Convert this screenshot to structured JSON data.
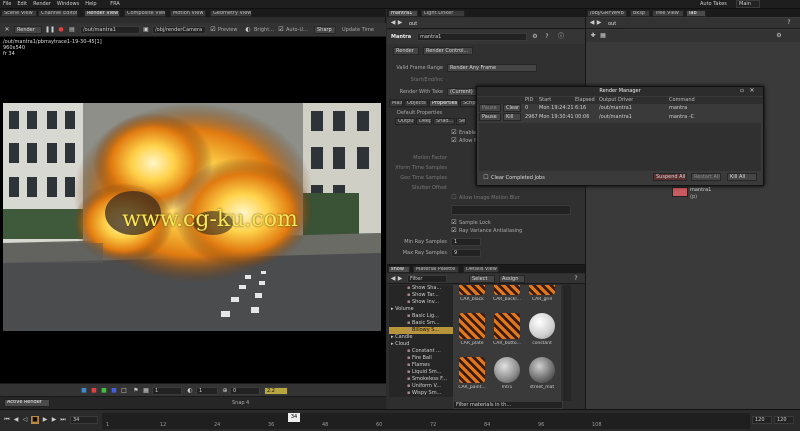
{
  "menubar": {
    "items": [
      "File",
      "Edit",
      "Render",
      "Windows",
      "Help"
    ],
    "extra": "FRA",
    "right_label": "Auto Takes",
    "right_field": "Main"
  },
  "left_tabs": [
    "Scene View",
    "Channel Editor",
    "Render View",
    "Composite View",
    "Motion View",
    "Geometry View"
  ],
  "viewer_toolbar": {
    "render_button": "Render",
    "path_field": "/out/mantra1",
    "camera_field": "/obj/renderCamera",
    "preview_label": "Preview",
    "brightness_label": "Bright...",
    "auto_label": "Auto-U...",
    "sharp_label": "Sharp",
    "update_label": "Update Time"
  },
  "viewer": {
    "path_label": "/out/mantra1/pbrraytrace1-19-30-45[1]",
    "info_line1": "960x540",
    "info_line2": "fr 34"
  },
  "viewer_bottom": {
    "frame_field": "1",
    "value_field": "1",
    "zoom_field": "0",
    "exposure_field": "2.2",
    "snap_label": "Snap",
    "snap_value": "4"
  },
  "status_bar": {
    "active_render_tab": "Active Render"
  },
  "timeline": {
    "frame_field": "34",
    "ticks": [
      "1",
      "12",
      "24",
      "36",
      "48",
      "60",
      "72",
      "84",
      "96",
      "108"
    ],
    "current_frame": "34",
    "end_field": "120",
    "end_field2": "120"
  },
  "mid_tabs": [
    "mantra1",
    "Light Linker"
  ],
  "mid_path": "out",
  "mantra": {
    "node_type": "Mantra",
    "node_name": "mantra1",
    "render_button": "Render",
    "render_control_button": "Render Control...",
    "frame_range_label": "Valid Frame Range",
    "frame_range_value": "Render Any Frame",
    "start_end_label": "Start/End/Inc",
    "render_takes_label": "Render With Take",
    "render_takes_value": "(Current)",
    "tabs": [
      "Main",
      "Objects",
      "Properties",
      "Script"
    ],
    "sub_label": "Default Properties",
    "sub_tabs": [
      "Output",
      "Deep",
      "Shad...",
      "Se"
    ],
    "enable_label": "Enable",
    "allow_label": "Allow M...",
    "faint_rows": [
      "Motion Factor",
      "Xform Time Samples",
      "Geo Time Samples",
      "Shutter Offset"
    ],
    "allow_image_blur": "Allow Image Motion Blur",
    "sample_lock": "Sample Lock",
    "ray_variance": "Ray Variance Antialiasing",
    "min_ray_label": "Min Ray Samples",
    "min_ray_value": "1",
    "max_ray_label": "Max Ray Samples",
    "max_ray_value": "9"
  },
  "render_manager": {
    "title": "Render Manager",
    "columns": [
      "PID",
      "Start",
      "Elapsed",
      "Output Driver",
      "Command"
    ],
    "rows": [
      {
        "pause": "Pause",
        "action": "Clear",
        "pid": "0",
        "start": "Mon 19:24:21",
        "elapsed": "6:16",
        "driver": "/out/mantra1",
        "command": "mantra"
      },
      {
        "pause": "Pause",
        "action": "Kill",
        "pid": "2967",
        "start": "Mon 19:30:41",
        "elapsed": "00:06",
        "driver": "/out/mantra1",
        "command": "mantra -C"
      }
    ],
    "clear_completed": "Clear Completed Jobs",
    "suspend_button": "Suspend All",
    "restart_button": "Restart All",
    "kill_button": "Kill All"
  },
  "lower_tabs": [
    "show",
    "Material Palette",
    "Details View"
  ],
  "material_panel": {
    "filter_label": "Filter",
    "select_button": "Select",
    "assign_button": "Assign",
    "tree_items": [
      {
        "indent": 1,
        "label": "Show Sha..."
      },
      {
        "indent": 1,
        "label": "Show Tar..."
      },
      {
        "indent": 1,
        "label": "Show Inv..."
      },
      {
        "indent": 0,
        "label": "Volume"
      },
      {
        "indent": 1,
        "label": "Basic Lig..."
      },
      {
        "indent": 1,
        "label": "Basic Sm..."
      },
      {
        "indent": 1,
        "label": "Billowy S..."
      },
      {
        "indent": 0,
        "label": "Candle"
      },
      {
        "indent": 0,
        "label": "Cloud"
      },
      {
        "indent": 1,
        "label": "Constant ..."
      },
      {
        "indent": 1,
        "label": "Fire Ball"
      },
      {
        "indent": 1,
        "label": "Flames"
      },
      {
        "indent": 1,
        "label": "Liquid Sm..."
      },
      {
        "indent": 1,
        "label": "Smokeless F..."
      },
      {
        "indent": 1,
        "label": "Uniform V..."
      },
      {
        "indent": 1,
        "label": "Wispy Sm..."
      }
    ],
    "filter_field": "Filter materials in th...",
    "materials": [
      {
        "name": "CAR_black",
        "kind": "stripe"
      },
      {
        "name": "CAR_backl...",
        "kind": "stripe"
      },
      {
        "name": "CAR_grill",
        "kind": "stripe"
      },
      {
        "name": "CAR_plate",
        "kind": "stripe"
      },
      {
        "name": "CAR_botto...",
        "kind": "stripe"
      },
      {
        "name": "constant",
        "kind": "white"
      },
      {
        "name": "CAR_paint...",
        "kind": "stripe"
      },
      {
        "name": "mtr1",
        "kind": "gray"
      },
      {
        "name": "street_mat",
        "kind": "darkgray"
      },
      {
        "name": "stone",
        "kind": "stone"
      },
      {
        "name": "billowysmoke",
        "kind": "smoke"
      }
    ]
  },
  "right_tabs": [
    "/obj/GRFWMB",
    "Bksp",
    "Tree View",
    "lab"
  ],
  "right_path": "out",
  "network": {
    "node_name": "mantra1",
    "node_sub": "(p)"
  },
  "watermark": "www.cg-ku.com"
}
